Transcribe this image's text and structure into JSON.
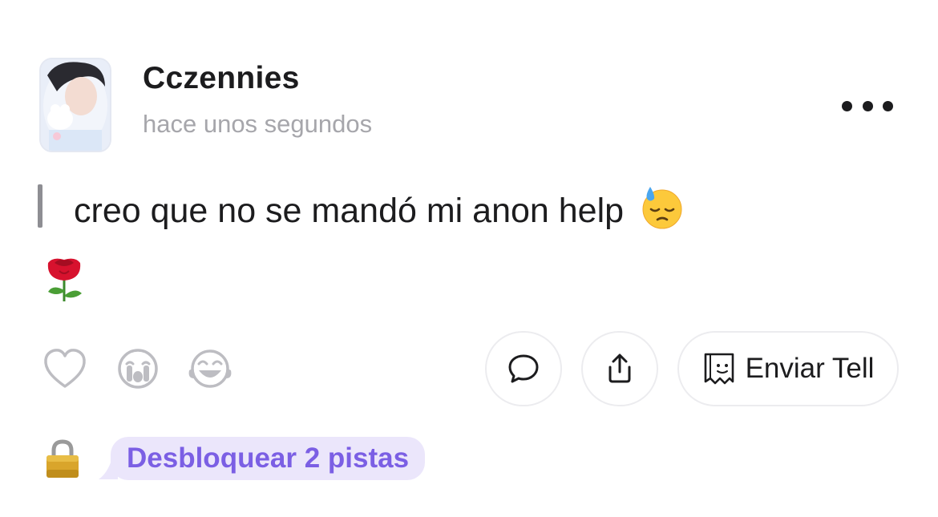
{
  "post": {
    "username": "Cczennies",
    "timestamp": "hace unos segundos",
    "message": "creo que no se mandó mi anon help",
    "message_emoji": "downcast-face-with-sweat",
    "attached_emoji": "rose"
  },
  "reactions": [
    "heart-outline-icon",
    "crying-face-icon",
    "tears-of-joy-icon"
  ],
  "actions": {
    "comment_icon": "speech-bubble-icon",
    "share_icon": "share-icon",
    "send_tell_label": "Enviar Tell"
  },
  "unlock": {
    "label": "Desbloquear 2 pistas"
  },
  "colors": {
    "text": "#1c1c1e",
    "muted": "#a6a6ab",
    "accent": "#7b5fe4",
    "accent_bg": "#ebe6fb",
    "border": "#ececef"
  }
}
